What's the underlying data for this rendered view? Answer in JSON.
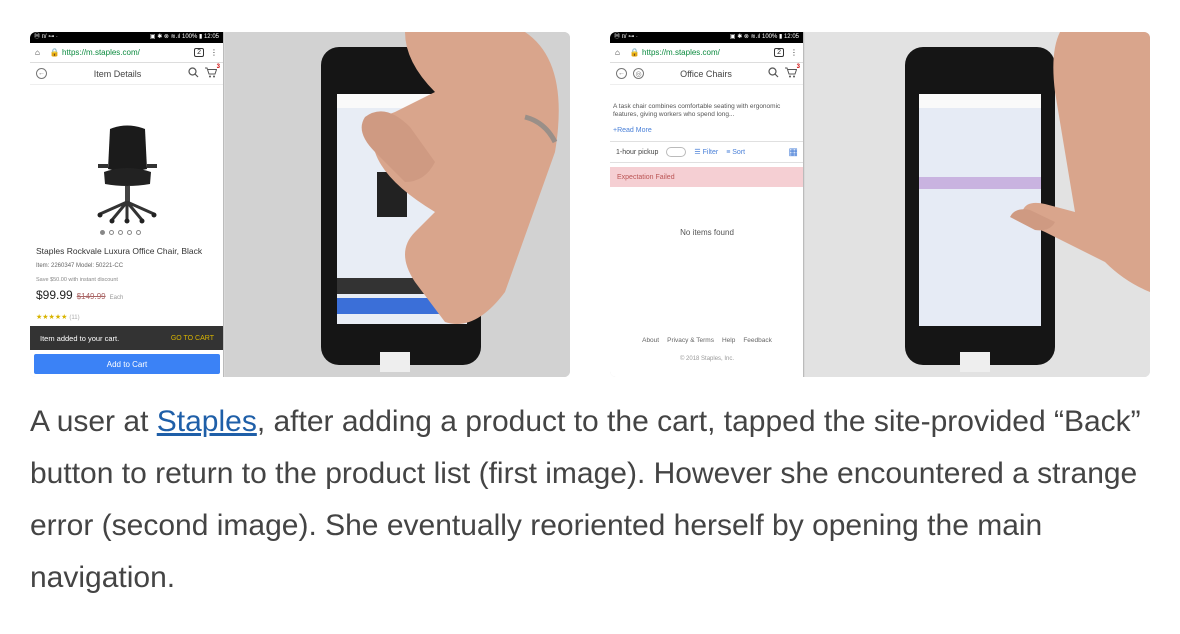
{
  "status_bar": {
    "left": "Ⓜ ᴨ/ ⊶ ·",
    "right": "▣ ✱ ⊗ ≋.ıl 100% ▮ 12:05"
  },
  "browser": {
    "url": "https://m.staples.com/",
    "tabs": "2",
    "menu": "⋮"
  },
  "figure1": {
    "page_title": "Item Details",
    "cart_badge": "3",
    "product_name": "Staples Rockvale Luxura Office Chair, Black",
    "meta": "Item: 2260347  Model: 50221-CC",
    "save": "Save $50.00 with instant discount",
    "price": "$99.99",
    "was_price": "$149.99",
    "unit": "Each",
    "stars": "★★★★★",
    "reviews": "(11)",
    "toast_text": "Item added to your cart.",
    "toast_link": "GO TO CART",
    "add_to_cart": "Add to Cart"
  },
  "figure2": {
    "page_title": "Office Chairs",
    "cart_badge": "3",
    "description": "A task chair combines comfortable seating with ergonomic features, giving workers who spend long...",
    "read_more": "+Read More",
    "pickup": "1-hour pickup",
    "filter": "Filter",
    "sort": "Sort",
    "error": "Expectation Failed",
    "no_items": "No items found",
    "footer_links": [
      "About",
      "Privacy & Terms",
      "Help",
      "Feedback"
    ],
    "copyright": "© 2018 Staples, Inc."
  },
  "caption": {
    "before_link": "A user at ",
    "link": "Staples",
    "after_link": ", after adding a product to the cart, tapped the site-provided “Back” button to return to the product list (first image). However she encountered a strange error (second image). She eventually reoriented herself by opening the main navigation."
  },
  "colors": {
    "link": "#1f5fa8",
    "error_bg": "#f5cfd3",
    "accent_blue": "#3b82f6",
    "star": "#d8b400"
  },
  "icons": [
    "home-icon",
    "lock-icon",
    "back-icon",
    "search-icon",
    "cart-icon",
    "filter-icon",
    "sort-icon",
    "grid-icon"
  ]
}
